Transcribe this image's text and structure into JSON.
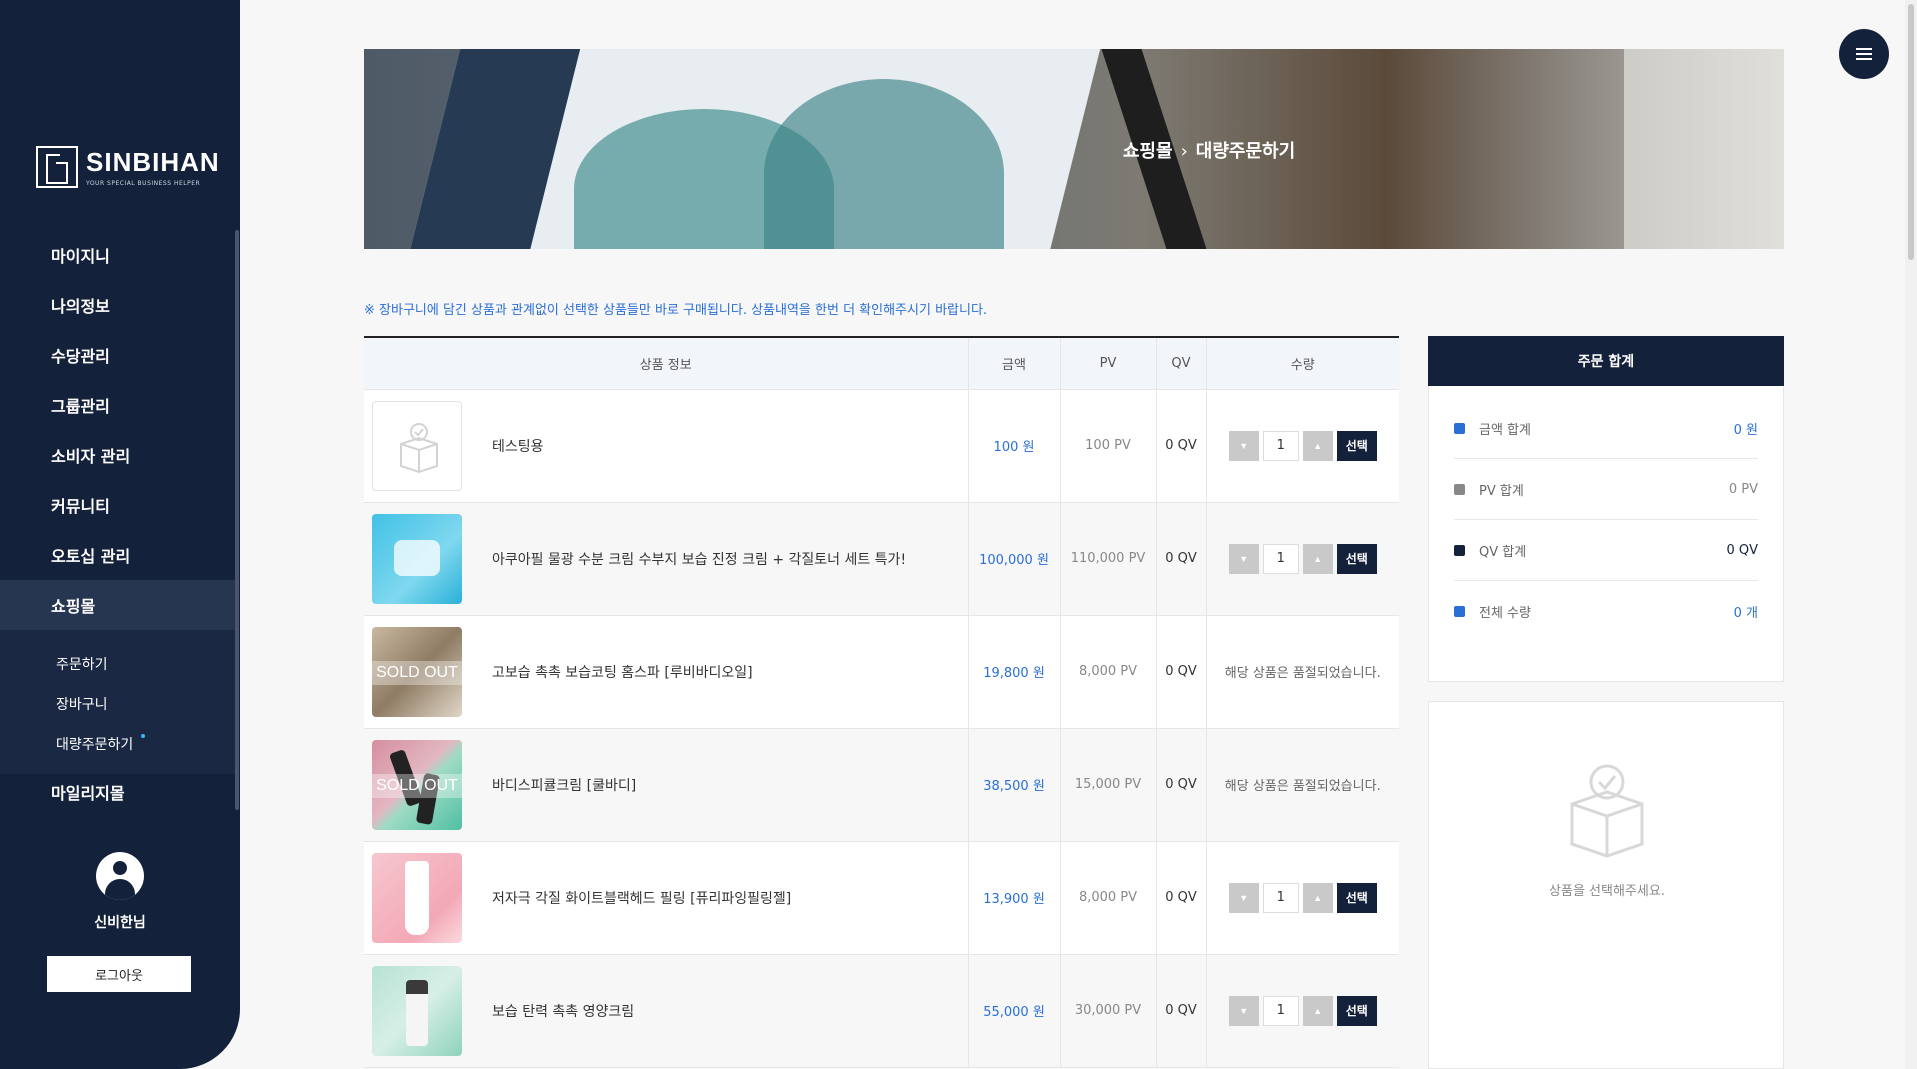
{
  "sidebar": {
    "logo": {
      "name": "SINBIHAN",
      "tagline": "YOUR SPECIAL BUSINESS HELPER"
    },
    "menu": [
      {
        "label": "마이지니"
      },
      {
        "label": "나의정보"
      },
      {
        "label": "수당관리"
      },
      {
        "label": "그룹관리"
      },
      {
        "label": "소비자 관리"
      },
      {
        "label": "커뮤니티"
      },
      {
        "label": "오토십 관리"
      },
      {
        "label": "쇼핑몰"
      }
    ],
    "submenu": [
      {
        "label": "주문하기"
      },
      {
        "label": "장바구니"
      },
      {
        "label": "대량주문하기"
      }
    ],
    "cut_item": "마일리지몰",
    "user": {
      "name": "신비한님"
    },
    "logout_label": "로그아웃"
  },
  "banner": {
    "crumb1": "쇼핑몰",
    "separator": "›",
    "crumb2": "대량주문하기"
  },
  "notice": "※ 장바구니에 담긴 상품과 관계없이 선택한 상품들만 바로 구매됩니다. 상품내역을 한번 더 확인해주시기 바랍니다.",
  "table": {
    "headers": {
      "info": "상품 정보",
      "price": "금액",
      "pv": "PV",
      "qv": "QV",
      "qty": "수량"
    },
    "rows": [
      {
        "name": "테스팅용",
        "price": "100 원",
        "pv": "100 PV",
        "qv": "0 QV",
        "qty": "1",
        "status": ""
      },
      {
        "name": "아쿠아필 물광 수분 크림 수부지 보습 진정 크림 + 각질토너 세트 특가!",
        "price": "100,000 원",
        "pv": "110,000 PV",
        "qv": "0 QV",
        "qty": "1",
        "status": ""
      },
      {
        "name": "고보습 촉촉 보습코팅 홈스파 [루비바디오일]",
        "price": "19,800 원",
        "pv": "8,000 PV",
        "qv": "0 QV",
        "qty": "",
        "status": "해당 상품은 품절되었습니다.",
        "badge": "SOLD OUT"
      },
      {
        "name": "바디스피큘크림 [쿨바디]",
        "price": "38,500 원",
        "pv": "15,000 PV",
        "qv": "0 QV",
        "qty": "",
        "status": "해당 상품은 품절되었습니다.",
        "badge": "SOLD OUT"
      },
      {
        "name": "저자극 각질 화이트블랙헤드 필링 [퓨리파잉필링젤]",
        "price": "13,900 원",
        "pv": "8,000 PV",
        "qv": "0 QV",
        "qty": "1",
        "status": ""
      },
      {
        "name": "보습 탄력 촉촉 영양크림",
        "price": "55,000 원",
        "pv": "30,000 PV",
        "qv": "0 QV",
        "qty": "1",
        "status": ""
      }
    ],
    "select_label": "선택",
    "down_arrow": "▼",
    "up_arrow": "▲"
  },
  "summary": {
    "title": "주문 합계",
    "rows": [
      {
        "label": "금액 합계",
        "value": "0 원",
        "color": "#2a6fd6"
      },
      {
        "label": "PV 합계",
        "value": "0 PV",
        "color": "#888888"
      },
      {
        "label": "QV 합계",
        "value": "0 QV",
        "color": "#14213a"
      },
      {
        "label": "전체 수량",
        "value": "0 개",
        "color": "#2a6fd6"
      }
    ],
    "empty_message": "상품을 선택해주세요."
  },
  "colors": {
    "navy": "#14213a",
    "accent_blue": "#2a6fd6"
  }
}
